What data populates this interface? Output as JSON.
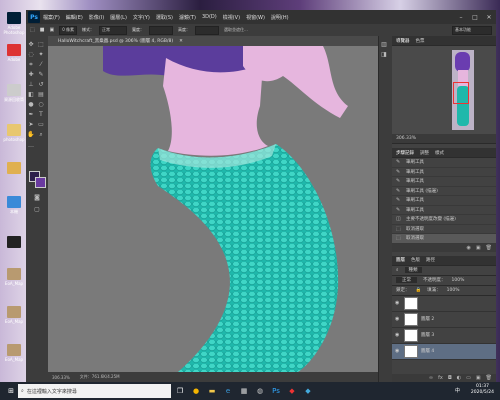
{
  "window": {
    "app_logo": "Ps",
    "menu": [
      "檔案(F)",
      "編輯(E)",
      "影像(I)",
      "圖層(L)",
      "文字(Y)",
      "選取(S)",
      "濾鏡(T)",
      "3D(D)",
      "檢視(V)",
      "視窗(W)",
      "說明(H)"
    ],
    "workspace_label": "基本功能"
  },
  "options_bar": {
    "field1": "0 像素",
    "mode_label": "樣式：",
    "mode_value": "正常",
    "width_label": "寬度：",
    "height_label": "高度：",
    "select_mask_label": "選取並遮住..."
  },
  "document": {
    "tab_title": "HalloWitchcraft_黑桑蟲.psd @ 306% (圖層 4, RGB/8)",
    "zoom": "306.33%",
    "doc_size": "文件：761.6K/4.25M"
  },
  "panels": {
    "navigator_tabs": [
      "導覽器",
      "色票"
    ],
    "navigator_zoom": "306.33%",
    "history_tabs": [
      "步驟記錄",
      "調整",
      "樣式"
    ],
    "history_items": [
      {
        "label": "筆刷工具",
        "selected": false
      },
      {
        "label": "筆刷工具",
        "selected": false
      },
      {
        "label": "筆刷工具",
        "selected": false
      },
      {
        "label": "筆刷工具 (描邊)",
        "selected": false
      },
      {
        "label": "筆刷工具",
        "selected": false
      },
      {
        "label": "筆刷工具",
        "selected": false
      },
      {
        "label": "主要不透明度改變 (描邊)",
        "selected": false
      },
      {
        "label": "取消選取",
        "selected": false
      },
      {
        "label": "取消選取",
        "selected": true
      }
    ],
    "layers_tabs": [
      "圖層",
      "色版",
      "路徑"
    ],
    "layers_kind": "種類",
    "layers_blend": "正常",
    "layers_opacity_label": "不透明度：",
    "layers_opacity": "100%",
    "layers_lock_label": "鎖定：",
    "layers_fill_label": "填滿：",
    "layers_fill": "100%",
    "layers": [
      {
        "name": "圖層 2",
        "selected": false
      },
      {
        "name": "圖層 3",
        "selected": false
      },
      {
        "name": "圖層 4",
        "selected": true
      }
    ]
  },
  "desktop_icons": [
    "Adobe Photoshop",
    "Adobe",
    "資源回收筒",
    "photoshop",
    "",
    "本機",
    "",
    "",
    "EoA_Map",
    "EoA_Map",
    "EoA_Map"
  ],
  "taskbar": {
    "search_placeholder": "在這裡輸入文字來搜尋",
    "time": "01:37",
    "date": "2020/5/24",
    "lang": "中"
  }
}
